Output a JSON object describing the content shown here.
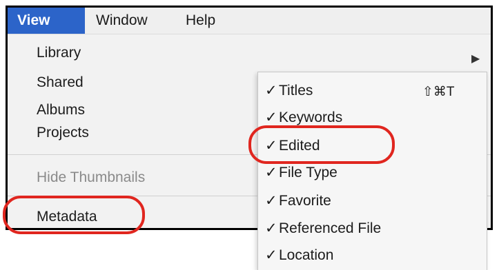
{
  "menubar": {
    "items": [
      {
        "label": "View",
        "active": true
      },
      {
        "label": "Window",
        "active": false
      },
      {
        "label": "Help",
        "active": false
      }
    ]
  },
  "view_menu": {
    "items": [
      {
        "label": "Library",
        "has_submenu": true
      },
      {
        "label": "Shared"
      },
      {
        "label": "Albums"
      },
      {
        "label": "Projects"
      },
      {
        "label": "Hide Thumbnails",
        "disabled": true
      },
      {
        "label": "Metadata",
        "highlighted": true
      }
    ],
    "submenu_arrow": "▶"
  },
  "metadata_submenu": {
    "check_glyph": "✓",
    "items": [
      {
        "label": "Titles",
        "checked": true,
        "shortcut": "⇧⌘T"
      },
      {
        "label": "Keywords",
        "checked": true
      },
      {
        "label": "Edited",
        "checked": true,
        "highlighted": true
      },
      {
        "label": "File Type",
        "checked": true
      },
      {
        "label": "Favorite",
        "checked": true
      },
      {
        "label": "Referenced File",
        "checked": true
      },
      {
        "label": "Location",
        "checked": true
      }
    ]
  },
  "colors": {
    "menu_selected": "#2c64c9",
    "annotation": "#e0261f"
  }
}
